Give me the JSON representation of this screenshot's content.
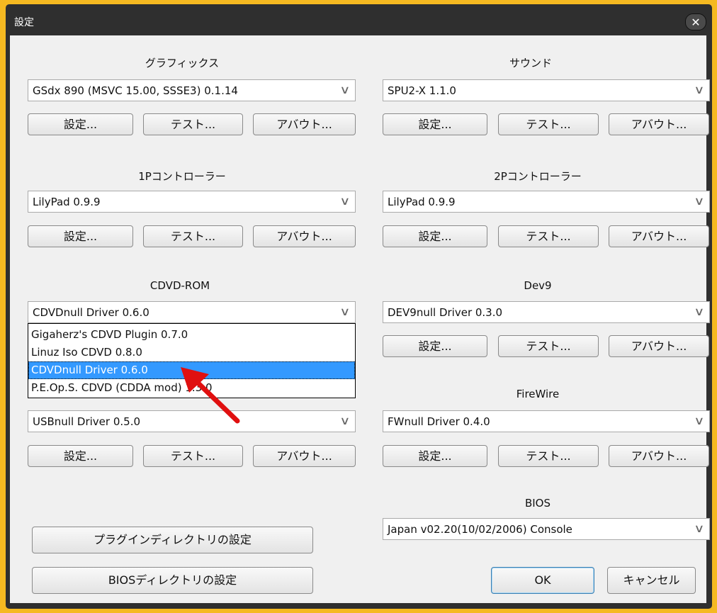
{
  "window": {
    "title": "設定",
    "close_glyph": "✕"
  },
  "arrow_glyph": "∨",
  "buttons": {
    "config": "設定...",
    "test": "テスト...",
    "about": "アバウト..."
  },
  "sections": {
    "graphics": {
      "label": "グラフィックス",
      "value": "GSdx 890 (MSVC 15.00, SSSE3) 0.1.14"
    },
    "sound": {
      "label": "サウンド",
      "value": "SPU2-X 1.1.0"
    },
    "pad1": {
      "label": "1Pコントローラー",
      "value": "LilyPad 0.9.9"
    },
    "pad2": {
      "label": "2Pコントローラー",
      "value": "LilyPad 0.9.9"
    },
    "cdvd": {
      "label": "CDVD-ROM",
      "value": "CDVDnull Driver 0.6.0"
    },
    "dev9": {
      "label": "Dev9",
      "value": "DEV9null Driver 0.3.0"
    },
    "usb": {
      "value": "USBnull Driver 0.5.0"
    },
    "firewire": {
      "label": "FireWire",
      "value": "FWnull Driver 0.4.0"
    },
    "bios": {
      "label": "BIOS",
      "value": "Japan  v02.20(10/02/2006) Console"
    }
  },
  "cdvd_dropdown": {
    "options": [
      "Gigaherz's CDVD Plugin 0.7.0",
      "Linuz Iso CDVD  0.8.0",
      "CDVDnull Driver 0.6.0",
      "P.E.Op.S. CDVD (CDDA mod) 1.3.0"
    ],
    "selected_index": 2
  },
  "footer": {
    "plugin_dir": "プラグインディレクトリの設定",
    "bios_dir": "BIOSディレクトリの設定",
    "ok": "OK",
    "cancel": "キャンセル"
  },
  "colors": {
    "accent_border": "#f5b921",
    "selection": "#3399ff",
    "pointer_arrow": "#e01010"
  }
}
